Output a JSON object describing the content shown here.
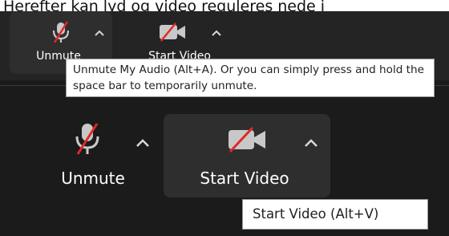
{
  "caption": {
    "text": "Herefter kan lyd og video reguleres nede i"
  },
  "toolbar_small": {
    "unmute_label": "Unmute",
    "start_video_label": "Start Video"
  },
  "tooltip_audio": {
    "text": "Unmute My Audio (Alt+A). Or you can simply press and hold the space bar to temporarily unmute."
  },
  "toolbar_large": {
    "unmute_label": "Unmute",
    "start_video_label": "Start Video"
  },
  "tooltip_video": {
    "text": "Start Video (Alt+V)"
  },
  "colors": {
    "background": "#1b1b1b",
    "button_highlight": "#2e2e2e",
    "icon_gray": "#c8c8c8",
    "mute_slash": "#e02828"
  },
  "icons": [
    "microphone-muted-icon",
    "video-off-icon",
    "caret-up-icon"
  ]
}
